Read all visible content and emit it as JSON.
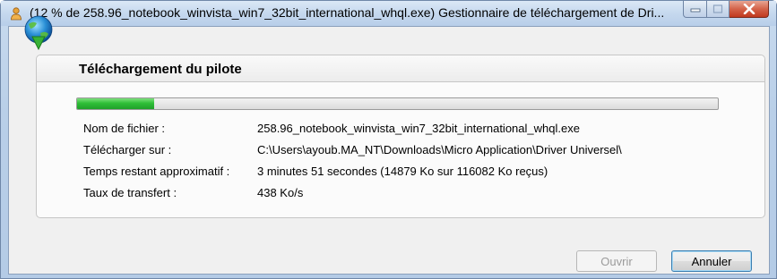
{
  "window": {
    "title": "(12 % de 258.96_notebook_winvista_win7_32bit_international_whql.exe) Gestionnaire de téléchargement de Dri..."
  },
  "header": {
    "title": "Téléchargement du pilote"
  },
  "progress": {
    "fraction": 0.12
  },
  "details": [
    {
      "label": "Nom de fichier :",
      "value": "258.96_notebook_winvista_win7_32bit_international_whql.exe"
    },
    {
      "label": "Télécharger sur :",
      "value": "C:\\Users\\ayoub.MA_NT\\Downloads\\Micro Application\\Driver Universel\\"
    },
    {
      "label": "Temps restant approximatif :",
      "value": "3 minutes 51 secondes (14879 Ko sur 116082 Ko reçus)"
    },
    {
      "label": "Taux de transfert :",
      "value": "438 Ko/s"
    }
  ],
  "buttons": {
    "open_label": "Ouvrir",
    "cancel_label": "Annuler"
  },
  "icons": {
    "app": "download-user-icon",
    "header": "globe-download-icon",
    "minimize": "minimize-icon",
    "maximize": "maximize-icon",
    "close": "close-icon"
  },
  "colors": {
    "progress_fill": "#2fbf38",
    "close_button": "#d4634a",
    "default_button_border": "#3c7fb1"
  }
}
